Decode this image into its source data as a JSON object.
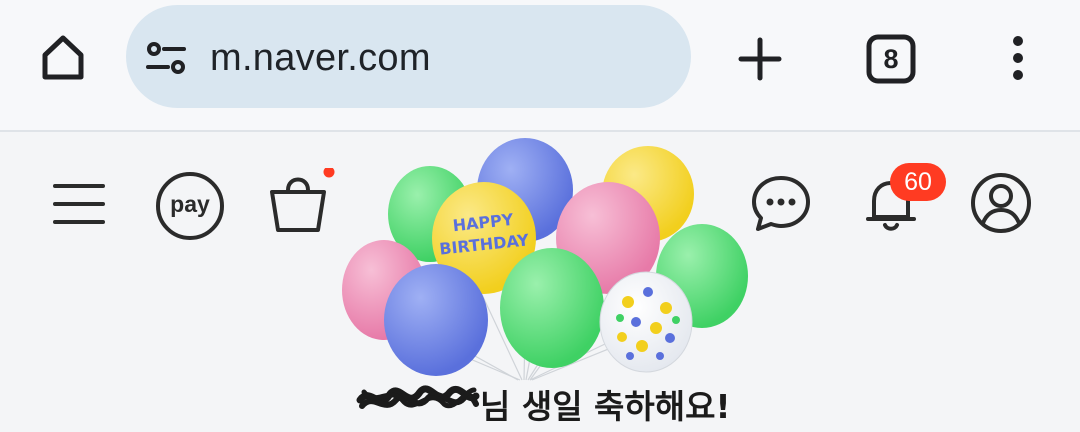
{
  "browser": {
    "url": "m.naver.com",
    "tab_count": "8",
    "icons": [
      "home-icon",
      "site-settings-icon",
      "new-tab-icon",
      "tab-switcher-icon",
      "more-menu-icon"
    ]
  },
  "naver_header": {
    "icons": [
      "menu-icon",
      "pay-icon",
      "shopping-bag-icon",
      "chat-icon",
      "bell-icon",
      "profile-icon"
    ],
    "pay_label": "pay",
    "notification_count": "60",
    "balloon_text": "HAPPY BIRTHDAY",
    "birthday_message": "님 생일 축하해요!"
  },
  "colors": {
    "url_pill": "#d9e6f0",
    "badge": "#ff3b22",
    "balloon_blue": "#6e84e6",
    "balloon_green": "#5edf7a",
    "balloon_pink": "#ef93b8",
    "balloon_yellow": "#f7d93a"
  }
}
